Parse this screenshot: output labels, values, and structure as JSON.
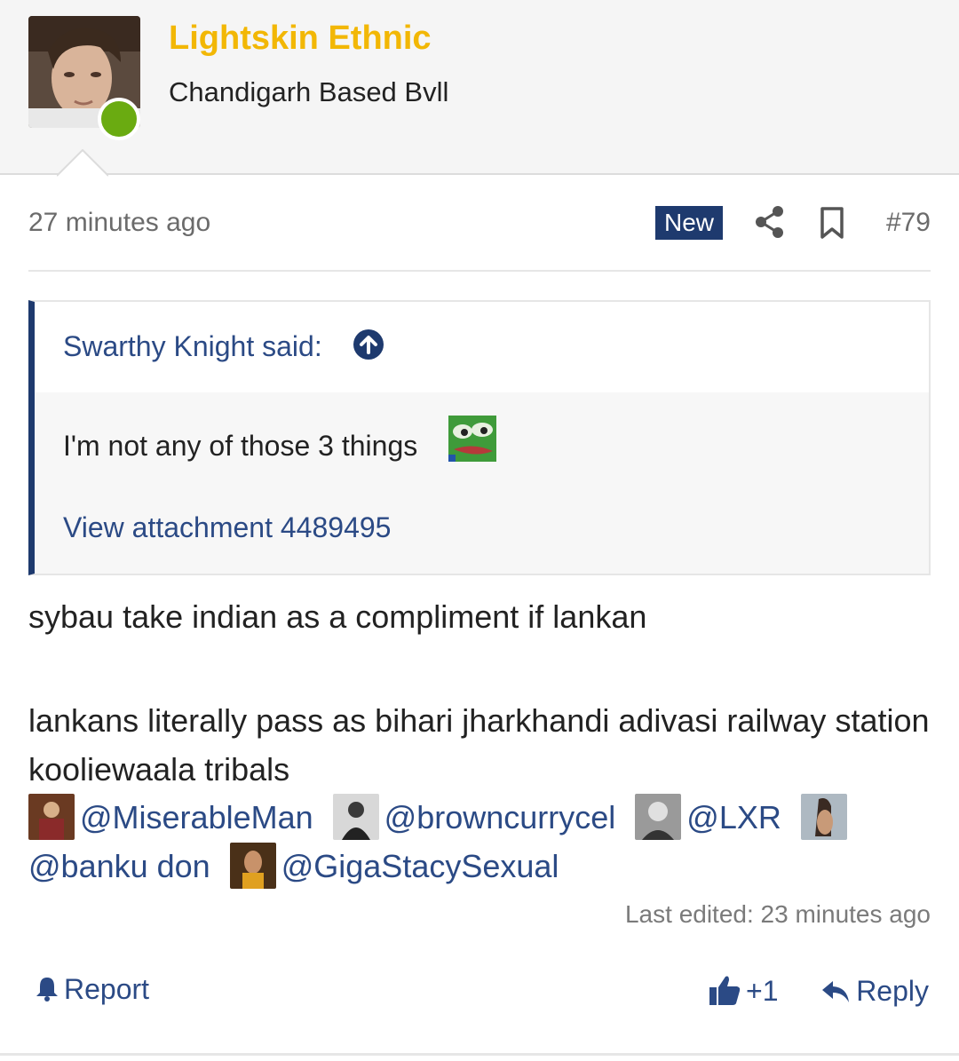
{
  "user": {
    "name": "Lightskin Ethnic",
    "title": "Chandigarh Based Bvll",
    "online": true
  },
  "post": {
    "timestamp": "27 minutes ago",
    "badge": "New",
    "number": "#79",
    "quote": {
      "author": "Swarthy Knight said:",
      "text": "I'm not any of those 3 things",
      "attachment": "View attachment 4489495"
    },
    "body_line1": "sybau take indian as a compliment if lankan",
    "body_line2": "lankans literally pass as bihari jharkhandi adivasi railway station kooliewaala tribals",
    "mentions": [
      "@MiserableMan",
      "@browncurrycel",
      "@LXR",
      "@banku don",
      "@GigaStacySexual"
    ],
    "last_edited": "Last edited: 23 minutes ago"
  },
  "actions": {
    "report": "Report",
    "like_count": "+1",
    "reply": "Reply"
  },
  "icons": [
    "share-icon",
    "bookmark-icon",
    "arrow-up-circle-icon",
    "bell-icon",
    "thumbs-up-icon",
    "reply-arrow-icon"
  ],
  "colors": {
    "accent": "#2b4a85",
    "badge": "#1e3a6e",
    "username": "#f2b705",
    "online": "#6aab11"
  }
}
